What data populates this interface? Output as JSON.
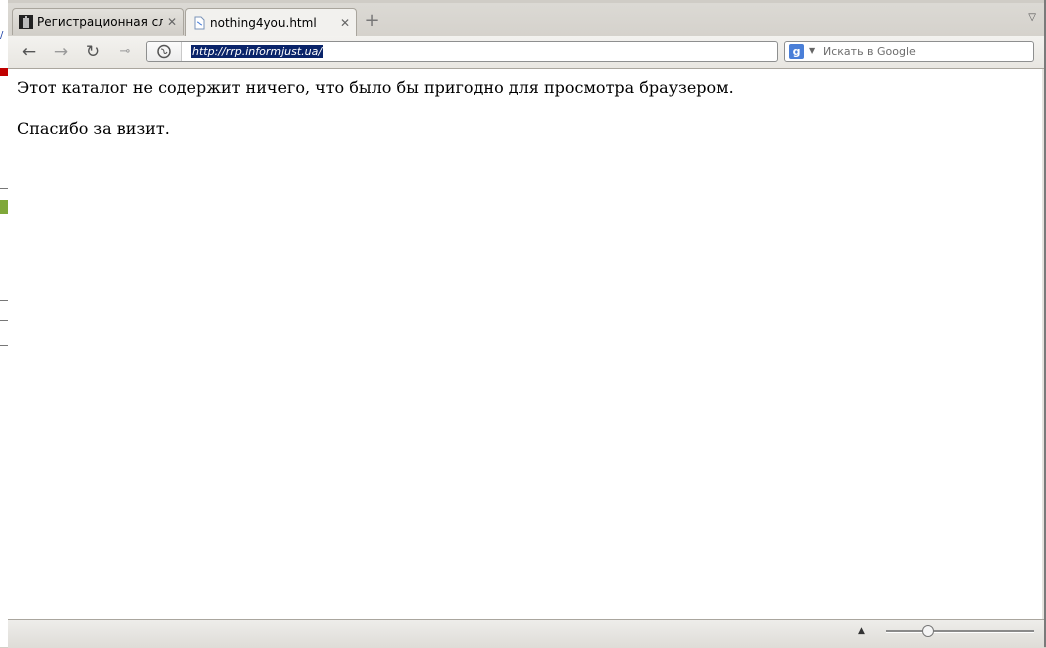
{
  "tabs": [
    {
      "label": "Регистрационная служ...",
      "active": false
    },
    {
      "label": "nothing4you.html",
      "active": true
    }
  ],
  "toolbar": {
    "back_icon": "back-arrow-icon",
    "forward_icon": "forward-arrow-icon",
    "reload_icon": "reload-icon",
    "key_icon": "key-icon",
    "site_icon": "globe-icon"
  },
  "address_bar": {
    "value": "http://rrp.informjust.ua/"
  },
  "search_bar": {
    "placeholder": "Искать в Google",
    "engine_icon": "google-icon"
  },
  "page": {
    "line1": "Этот каталог не содержит ничего, что было бы пригодно для просмотра браузером.",
    "line2": "Спасибо за визит."
  },
  "status": {
    "zoom_level": 0.28
  },
  "colors": {
    "selection": "#0a246a",
    "search_icon": "#4a7fd8"
  }
}
